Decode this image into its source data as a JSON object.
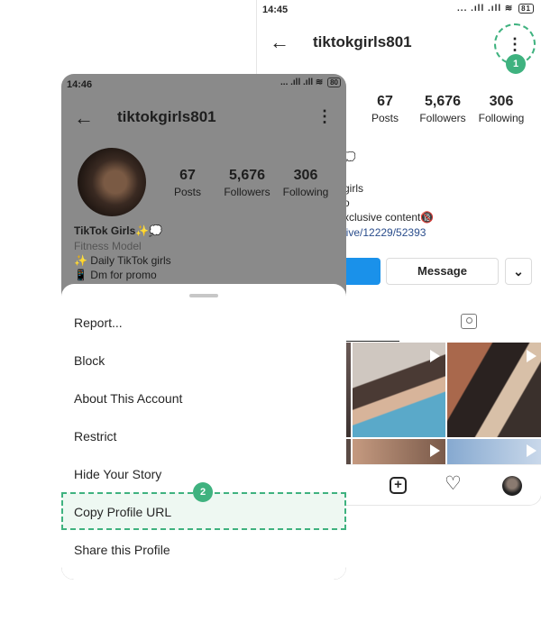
{
  "back_phone": {
    "status": {
      "time": "14:45",
      "icons": "... .ıll .ıll",
      "battery": "81"
    },
    "username": "tiktokgirls801",
    "step_marker": "1",
    "stats": [
      {
        "value": "67",
        "label": "Posts"
      },
      {
        "value": "5,676",
        "label": "Followers"
      },
      {
        "value": "306",
        "label": "Following"
      }
    ],
    "bio_fragments": [
      "girls",
      "o",
      "xclusive content🔞",
      "live/12229/52393"
    ],
    "message_button": "Message"
  },
  "front_phone": {
    "status": {
      "time": "14:46",
      "icons": "... .ıll .ıll",
      "battery": "80"
    },
    "username": "tiktokgirls801",
    "stats": [
      {
        "value": "67",
        "label": "Posts"
      },
      {
        "value": "5,676",
        "label": "Followers"
      },
      {
        "value": "306",
        "label": "Following"
      }
    ],
    "display_name": "TikTok Girls✨💭",
    "category": "Fitness Model",
    "bio_lines": [
      "✨ Daily TikTok girls",
      "📱 Dm for promo"
    ]
  },
  "sheet": {
    "items": [
      "Report...",
      "Block",
      "About This Account",
      "Restrict",
      "Hide Your Story",
      "Copy Profile URL",
      "Share this Profile"
    ],
    "step_marker": "2"
  },
  "colors": {
    "accent": "#3fb27f",
    "follow_blue": "#1a91ea",
    "overlay": "#8a8a8a"
  }
}
